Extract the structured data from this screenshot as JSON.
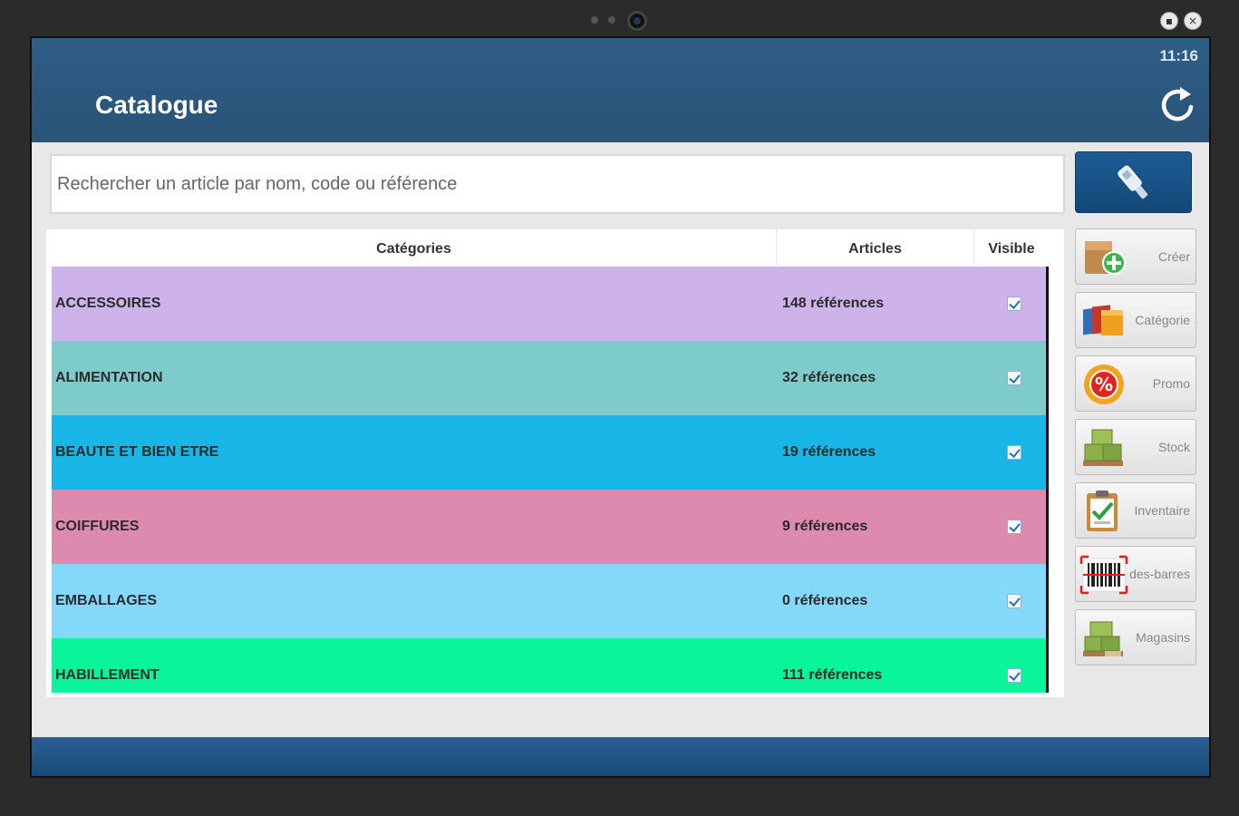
{
  "status": {
    "clock": "11:16"
  },
  "header": {
    "title": "Catalogue"
  },
  "search": {
    "placeholder": "Rechercher un article par nom, code ou référence"
  },
  "table": {
    "headers": {
      "categories": "Catégories",
      "articles": "Articles",
      "visible": "Visible"
    },
    "rows": [
      {
        "category": "ACCESSOIRES",
        "articles": "148 références",
        "visible": true,
        "color": "#cdb3ea"
      },
      {
        "category": "ALIMENTATION",
        "articles": "32 références",
        "visible": true,
        "color": "#7ecbcb"
      },
      {
        "category": "BEAUTE ET BIEN ETRE",
        "articles": "19 références",
        "visible": true,
        "color": "#18b6e6"
      },
      {
        "category": "COIFFURES",
        "articles": "9 références",
        "visible": true,
        "color": "#dc8bae"
      },
      {
        "category": "EMBALLAGES",
        "articles": "0 références",
        "visible": true,
        "color": "#84d9fb"
      },
      {
        "category": "HABILLEMENT",
        "articles": "111 références",
        "visible": true,
        "color": "#0af59a"
      }
    ]
  },
  "sidebar": {
    "buttons": [
      {
        "label": "Créer",
        "icon": "box-add-icon"
      },
      {
        "label": "Catégorie",
        "icon": "folders-icon"
      },
      {
        "label": "Promo",
        "icon": "percent-badge-icon"
      },
      {
        "label": "Stock",
        "icon": "boxes-icon"
      },
      {
        "label": "Inventaire",
        "icon": "clipboard-check-icon"
      },
      {
        "label": "des-barres",
        "icon": "barcode-icon"
      },
      {
        "label": "Magasins",
        "icon": "warehouse-boxes-icon"
      }
    ]
  },
  "colors": {
    "topbar": "#2a5478",
    "accent": "#114877"
  }
}
